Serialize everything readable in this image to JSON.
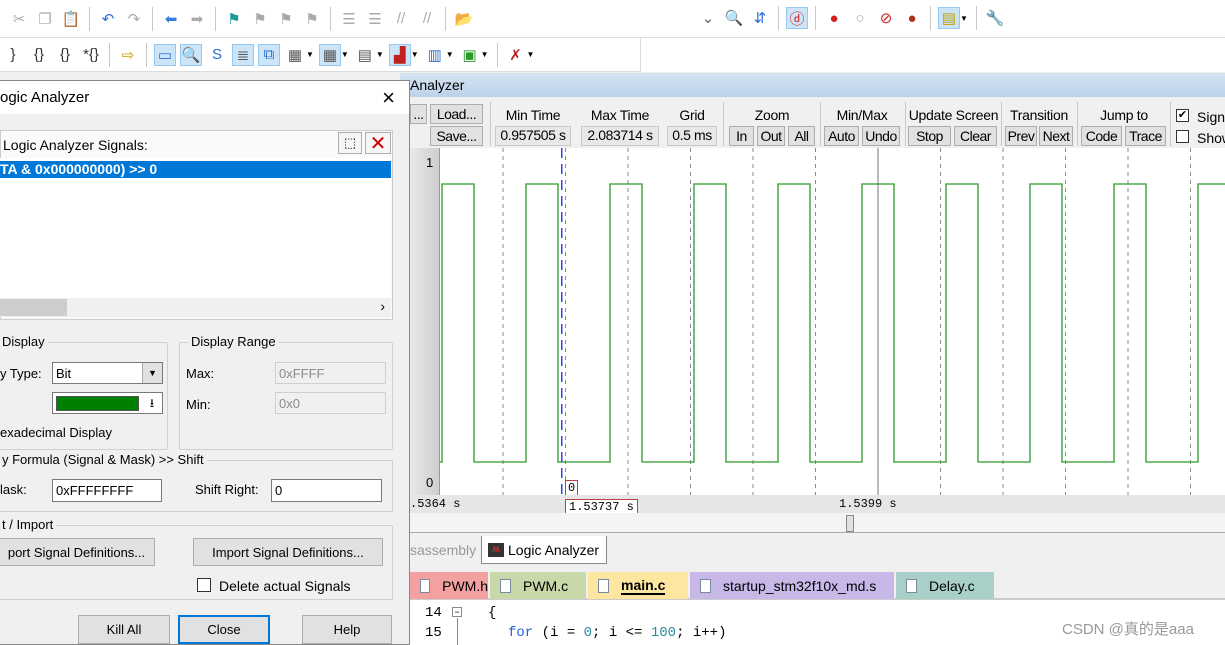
{
  "toolbar1": {
    "icons": [
      {
        "n": "cut-icon",
        "g": "✂",
        "c": "#aaa"
      },
      {
        "n": "copy-icon",
        "g": "❐",
        "c": "#aaa"
      },
      {
        "n": "paste-icon",
        "g": "📋",
        "c": "#b08020"
      },
      {
        "sep": 1
      },
      {
        "n": "undo-icon",
        "g": "↶",
        "c": "#2a6fd0"
      },
      {
        "n": "redo-icon",
        "g": "↷",
        "c": "#aaa"
      },
      {
        "sep": 1
      },
      {
        "n": "nav-back-icon",
        "g": "⬅",
        "c": "#3a7fe0"
      },
      {
        "n": "nav-forward-icon",
        "g": "➡",
        "c": "#aaa"
      },
      {
        "sep": 1
      },
      {
        "n": "bookmark-icon",
        "g": "⚑",
        "c": "#1a9a9a"
      },
      {
        "n": "bookmark-prev-icon",
        "g": "⚑",
        "c": "#aaa"
      },
      {
        "n": "bookmark-next-icon",
        "g": "⚑",
        "c": "#aaa"
      },
      {
        "n": "bookmark-clear-icon",
        "g": "⚑",
        "c": "#aaa"
      },
      {
        "sep": 1
      },
      {
        "n": "indent-icon",
        "g": "☰",
        "c": "#aaa"
      },
      {
        "n": "unindent-icon",
        "g": "☰",
        "c": "#aaa"
      },
      {
        "n": "comment-icon",
        "g": "//",
        "c": "#aaa"
      },
      {
        "n": "uncomment-icon",
        "g": "//",
        "c": "#aaa"
      },
      {
        "sep": 1
      },
      {
        "n": "find-in-files-icon",
        "g": "📂",
        "c": "#c09020"
      }
    ],
    "icons_right": [
      {
        "n": "combo-dropdown-icon",
        "g": "⌄",
        "c": "#666"
      },
      {
        "n": "find-icon",
        "g": "🔍",
        "c": "#333"
      },
      {
        "n": "incremental-find-icon",
        "g": "⇵",
        "c": "#2a6fd0"
      },
      {
        "sep": 1
      },
      {
        "n": "debug-session-icon",
        "g": "ⓓ",
        "c": "#d02020",
        "on": 1
      },
      {
        "sep": 1
      },
      {
        "n": "breakpoint-insert-icon",
        "g": "●",
        "c": "#d02020"
      },
      {
        "n": "breakpoint-enable-icon",
        "g": "○",
        "c": "#aaa"
      },
      {
        "n": "breakpoint-disable-all-icon",
        "g": "⊘",
        "c": "#d02020"
      },
      {
        "n": "breakpoint-kill-all-icon",
        "g": "●",
        "c": "#b03020"
      },
      {
        "sep": 1
      },
      {
        "n": "window-layout-icon",
        "g": "▤",
        "c": "#c0a000",
        "on": 1,
        "dd": 1
      },
      {
        "sep": 1
      },
      {
        "n": "configure-icon",
        "g": "🔧",
        "c": "#2a6fd0"
      }
    ]
  },
  "toolbar2": {
    "icons": [
      {
        "n": "step-icon",
        "g": "}",
        "c": "#333"
      },
      {
        "n": "step-over-icon",
        "g": "{}",
        "c": "#333"
      },
      {
        "n": "step-out-icon",
        "g": "{}",
        "c": "#333"
      },
      {
        "n": "run-to-cursor-icon",
        "g": "*{}",
        "c": "#333"
      },
      {
        "sep": 1
      },
      {
        "n": "show-next-statement-icon",
        "g": "⇨",
        "c": "#c0a000"
      },
      {
        "sep": 1
      },
      {
        "n": "command-window-icon",
        "g": "▭",
        "c": "#2a6fd0",
        "on": 1
      },
      {
        "n": "disassembly-window-icon",
        "g": "🔍",
        "c": "#333",
        "on": 1
      },
      {
        "n": "symbols-window-icon",
        "g": "S",
        "c": "#2a6fd0"
      },
      {
        "n": "registers-window-icon",
        "g": "≣",
        "c": "#555",
        "on": 1
      },
      {
        "n": "call-stack-window-icon",
        "g": "⧉",
        "c": "#2a6fd0",
        "on": 1
      },
      {
        "n": "watch-window-icon",
        "g": "▦",
        "c": "#555",
        "dd": 1
      },
      {
        "n": "memory-window-icon",
        "g": "▦",
        "c": "#555",
        "on": 1,
        "dd": 1
      },
      {
        "n": "serial-window-icon",
        "g": "▤",
        "c": "#555",
        "dd": 1
      },
      {
        "n": "analysis-window-icon",
        "g": "▟",
        "c": "#c02020",
        "on": 1,
        "dd": 1
      },
      {
        "n": "trace-window-icon",
        "g": "▥",
        "c": "#2a6fd0",
        "dd": 1
      },
      {
        "n": "system-viewer-icon",
        "g": "▣",
        "c": "#2a9a2a",
        "dd": 1
      },
      {
        "sep": 1
      },
      {
        "n": "toolbox-icon",
        "g": "✗",
        "c": "#c02020",
        "dd": 1
      }
    ]
  },
  "la": {
    "window_title": "Analyzer",
    "setup_label": "...",
    "load_label": "Load...",
    "save_label": "Save...",
    "min_time_label": "Min Time",
    "min_time": "0.957505 s",
    "max_time_label": "Max Time",
    "max_time": "2.083714 s",
    "grid_label": "Grid",
    "grid": "0.5 ms",
    "zoom_label": "Zoom",
    "zoom_in": "In",
    "zoom_out": "Out",
    "zoom_all": "All",
    "minmax_label": "Min/Max",
    "auto": "Auto",
    "undo": "Undo",
    "update_label": "Update Screen",
    "stop": "Stop",
    "clear": "Clear",
    "transition_label": "Transition",
    "prev": "Prev",
    "next": "Next",
    "jump_label": "Jump to",
    "code": "Code",
    "trace": "Trace",
    "signal_info_label": "Signal",
    "show_cycles_label": "Show",
    "signal_info_checked": true,
    "show_cycles_checked": false,
    "y_max_label": "1",
    "y_min_label": "0",
    "cursor_value": "0",
    "time_left": ".5364 s",
    "time_cursor": "1.53737 s",
    "time_mid": "1.5399 s"
  },
  "chart_data": {
    "type": "line",
    "step": true,
    "signal_color": "#2a9a2a",
    "ylim": [
      0,
      1
    ],
    "view_start_s": 1.536396,
    "view_end_s": 1.542676,
    "grid_ms": 0.5,
    "grid_origin_s": 1.5369,
    "first_rise_s": 1.536412,
    "period_ms": 0.672,
    "high_ms": 0.256,
    "cursor_s": 1.53737,
    "marker_s": 1.5399
  },
  "bottom_tabs": {
    "disassembly": "sassembly",
    "logic_analyzer": "Logic Analyzer"
  },
  "file_tabs": [
    {
      "label": "PWM.h",
      "color": "#f2a0a0"
    },
    {
      "label": "PWM.c",
      "color": "#c8d8a8"
    },
    {
      "label": "main.c",
      "color": "#fde7a0",
      "active": true
    },
    {
      "label": "startup_stm32f10x_md.s",
      "color": "#c8b8e8"
    },
    {
      "label": "Delay.c",
      "color": "#a8d0c8"
    }
  ],
  "code": [
    {
      "ln": "14",
      "text": "{"
    },
    {
      "ln": "15",
      "kw": "for",
      "rest1": " (i = ",
      "n1": "0",
      "rest2": "; i <= ",
      "n2": "100",
      "rest3": "; i++)"
    }
  ],
  "watermark": "CSDN @真的是aaa",
  "dialog": {
    "title": "ogic Analyzer",
    "signals_label": "Logic Analyzer Signals:",
    "signal_item": "TA & 0x000000000) >> 0",
    "display_group": "Display",
    "display_type_label": "y Type:",
    "display_type": "Bit",
    "color": "#008000",
    "hex_label": "exadecimal Display",
    "range_group": "Display Range",
    "max_label": "Max:",
    "max": "0xFFFF",
    "min_label": "Min:",
    "min": "0x0",
    "formula_group": "y Formula (Signal & Mask) >> Shift",
    "mask_label": "lask:",
    "mask": "0xFFFFFFFF",
    "shift_label": "Shift Right:",
    "shift": "0",
    "import_group": "t / Import",
    "export_btn": "port Signal Definitions...",
    "import_btn": "Import Signal Definitions...",
    "delete_label": "Delete actual Signals",
    "delete_checked": false,
    "kill_all": "Kill All",
    "close": "Close",
    "help": "Help"
  }
}
